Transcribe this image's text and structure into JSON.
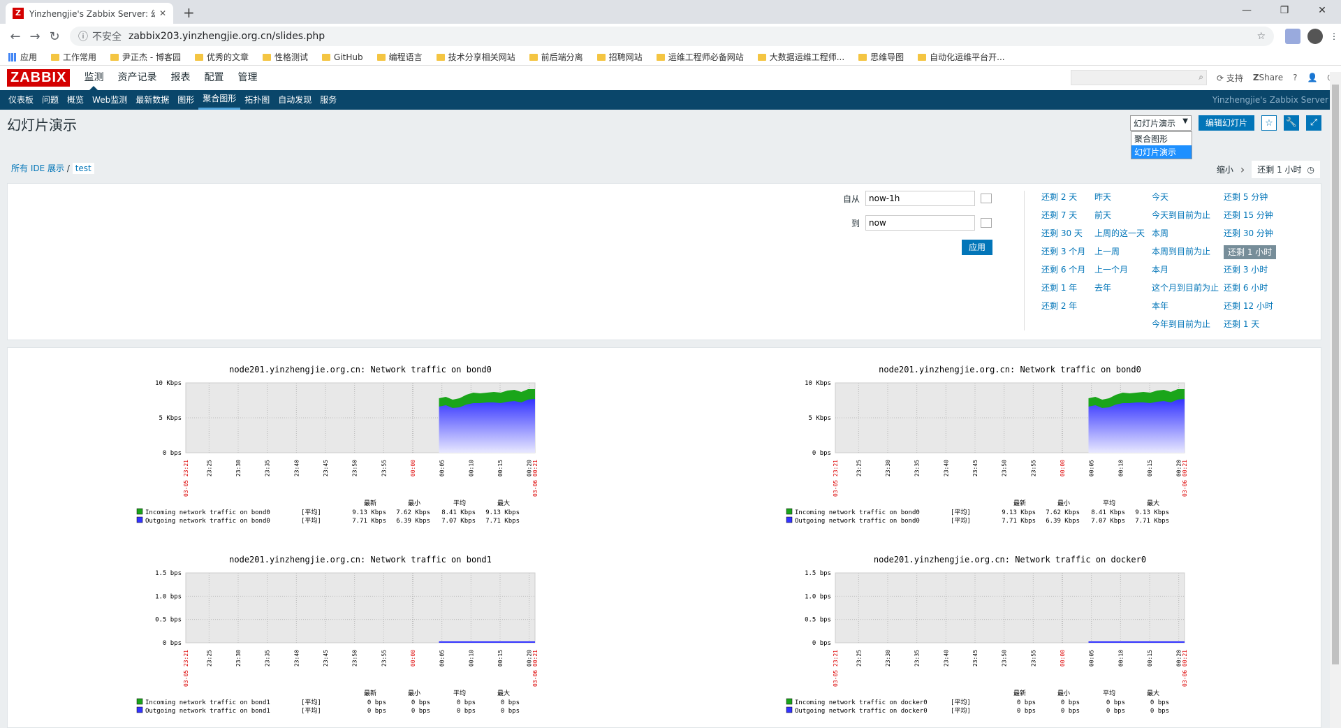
{
  "browser": {
    "tab_title": "Yinzhengjie's Zabbix Server: 幻",
    "insecure": "不安全",
    "url": "zabbix203.yinzhengjie.org.cn/slides.php",
    "bookmarks": [
      "应用",
      "工作常用",
      "尹正杰 - 博客园",
      "优秀的文章",
      "性格测试",
      "GitHub",
      "编程语言",
      "技术分享相关网站",
      "前后端分离",
      "招聘网站",
      "运维工程师必备网站",
      "大数据运维工程师...",
      "思维导图",
      "自动化运维平台开..."
    ]
  },
  "zabbix": {
    "logo": "ZABBIX",
    "top_menu": [
      "监测",
      "资产记录",
      "报表",
      "配置",
      "管理"
    ],
    "support": "支持",
    "share": "Share",
    "help": "?",
    "sub_menu": [
      "仪表板",
      "问题",
      "概览",
      "Web监测",
      "最新数据",
      "图形",
      "聚合图形",
      "拓扑图",
      "自动发现",
      "服务"
    ],
    "server_name": "Yinzhengjie's Zabbix Server",
    "page_title": "幻灯片演示",
    "select_value": "幻灯片演示",
    "select_options": [
      "聚合图形",
      "幻灯片演示"
    ],
    "edit_button": "编辑幻灯片",
    "breadcrumb_root": "所有 IDE 展示",
    "breadcrumb_sep": "/",
    "breadcrumb_leaf": "test",
    "zoom_out": "缩小",
    "time_tab": "还剩 1 小时"
  },
  "filter": {
    "from_label": "自从",
    "from_value": "now-1h",
    "to_label": "到",
    "to_value": "now",
    "apply": "应用",
    "quick": [
      [
        "还剩 2 天",
        "还剩 7 天",
        "还剩 30 天",
        "还剩 3 个月",
        "还剩 6 个月",
        "还剩 1 年",
        "还剩 2 年"
      ],
      [
        "昨天",
        "前天",
        "上周的这一天",
        "上一周",
        "上一个月",
        "去年"
      ],
      [
        "今天",
        "今天到目前为止",
        "本周",
        "本周到目前为止",
        "本月",
        "这个月到目前为止",
        "本年",
        "今年到目前为止"
      ],
      [
        "还剩 5 分钟",
        "还剩 15 分钟",
        "还剩 30 分钟",
        "还剩 1 小时",
        "还剩 3 小时",
        "还剩 6 小时",
        "还剩 12 小时",
        "还剩 1 天"
      ]
    ],
    "active": "还剩 1 小时"
  },
  "graphs": [
    {
      "title": "node201.yinzhengjie.org.cn: Network traffic on bond0",
      "y_ticks": [
        "10 Kbps",
        "5 Kbps",
        "0 bps"
      ],
      "x_ticks": [
        "23:25",
        "23:30",
        "23:35",
        "23:40",
        "23:45",
        "23:50",
        "23:55",
        "00:00",
        "00:05",
        "00:10",
        "00:15",
        "00:20"
      ],
      "x_start": "03-05 23:21",
      "x_end": "03-06 00:21",
      "ymax": 10,
      "legend_header": [
        "最新",
        "最小",
        "平均",
        "最大"
      ],
      "legend": [
        {
          "name": "Incoming network traffic on bond0",
          "func": "[平均]",
          "vals": [
            "9.13 Kbps",
            "7.62 Kbps",
            "8.41 Kbps",
            "9.13 Kbps"
          ],
          "color": "#1aa51a"
        },
        {
          "name": "Outgoing network traffic on bond0",
          "func": "[平均]",
          "vals": [
            "7.71 Kbps",
            "6.39 Kbps",
            "7.07 Kbps",
            "7.71 Kbps"
          ],
          "color": "#3333ff"
        }
      ],
      "series": [
        {
          "name": "Incoming network traffic on bond0",
          "start_min": 43.5,
          "values": [
            7.8,
            8.0,
            7.6,
            7.8,
            8.3,
            8.6,
            8.5,
            8.6,
            8.7,
            8.6,
            8.9,
            9.0,
            8.7,
            9.1,
            9.1
          ]
        },
        {
          "name": "Outgoing network traffic on bond0",
          "start_min": 43.5,
          "values": [
            6.6,
            6.8,
            6.4,
            6.5,
            6.9,
            7.1,
            7.1,
            7.2,
            7.2,
            7.1,
            7.3,
            7.4,
            7.2,
            7.6,
            7.7
          ]
        }
      ]
    },
    {
      "title": "node201.yinzhengjie.org.cn: Network traffic on bond0",
      "y_ticks": [
        "10 Kbps",
        "5 Kbps",
        "0 bps"
      ],
      "x_ticks": [
        "23:25",
        "23:30",
        "23:35",
        "23:40",
        "23:45",
        "23:50",
        "23:55",
        "00:00",
        "00:05",
        "00:10",
        "00:15",
        "00:20"
      ],
      "x_start": "03-05 23:21",
      "x_end": "03-06 00:21",
      "ymax": 10,
      "legend_header": [
        "最新",
        "最小",
        "平均",
        "最大"
      ],
      "legend": [
        {
          "name": "Incoming network traffic on bond0",
          "func": "[平均]",
          "vals": [
            "9.13 Kbps",
            "7.62 Kbps",
            "8.41 Kbps",
            "9.13 Kbps"
          ],
          "color": "#1aa51a"
        },
        {
          "name": "Outgoing network traffic on bond0",
          "func": "[平均]",
          "vals": [
            "7.71 Kbps",
            "6.39 Kbps",
            "7.07 Kbps",
            "7.71 Kbps"
          ],
          "color": "#3333ff"
        }
      ],
      "series": [
        {
          "name": "Incoming network traffic on bond0",
          "start_min": 43.5,
          "values": [
            7.8,
            8.0,
            7.6,
            7.8,
            8.3,
            8.6,
            8.5,
            8.6,
            8.7,
            8.6,
            8.9,
            9.0,
            8.7,
            9.1,
            9.1
          ]
        },
        {
          "name": "Outgoing network traffic on bond0",
          "start_min": 43.5,
          "values": [
            6.6,
            6.8,
            6.4,
            6.5,
            6.9,
            7.1,
            7.1,
            7.2,
            7.2,
            7.1,
            7.3,
            7.4,
            7.2,
            7.6,
            7.7
          ]
        }
      ]
    },
    {
      "title": "node201.yinzhengjie.org.cn: Network traffic on bond1",
      "y_ticks": [
        "1.5 bps",
        "1.0 bps",
        "0.5 bps",
        "0 bps"
      ],
      "x_ticks": [
        "23:25",
        "23:30",
        "23:35",
        "23:40",
        "23:45",
        "23:50",
        "23:55",
        "00:00",
        "00:05",
        "00:10",
        "00:15",
        "00:20"
      ],
      "x_start": "03-05 23:21",
      "x_end": "03-06 00:21",
      "ymax": 1.5,
      "legend_header": [
        "最新",
        "最小",
        "平均",
        "最大"
      ],
      "legend": [
        {
          "name": "Incoming network traffic on bond1",
          "func": "[平均]",
          "vals": [
            "0 bps",
            "0 bps",
            "0 bps",
            "0 bps"
          ],
          "color": "#1aa51a"
        },
        {
          "name": "Outgoing network traffic on bond1",
          "func": "[平均]",
          "vals": [
            "0 bps",
            "0 bps",
            "0 bps",
            "0 bps"
          ],
          "color": "#3333ff"
        }
      ],
      "series": [
        {
          "name": "Outgoing network traffic on bond1",
          "start_min": 43.5,
          "values": [
            0,
            0,
            0,
            0,
            0,
            0,
            0,
            0,
            0,
            0,
            0,
            0,
            0,
            0,
            0
          ]
        }
      ]
    },
    {
      "title": "node201.yinzhengjie.org.cn: Network traffic on docker0",
      "y_ticks": [
        "1.5 bps",
        "1.0 bps",
        "0.5 bps",
        "0 bps"
      ],
      "x_ticks": [
        "23:25",
        "23:30",
        "23:35",
        "23:40",
        "23:45",
        "23:50",
        "23:55",
        "00:00",
        "00:05",
        "00:10",
        "00:15",
        "00:20"
      ],
      "x_start": "03-05 23:21",
      "x_end": "03-06 00:21",
      "ymax": 1.5,
      "legend_header": [
        "最新",
        "最小",
        "平均",
        "最大"
      ],
      "legend": [
        {
          "name": "Incoming network traffic on docker0",
          "func": "[平均]",
          "vals": [
            "0 bps",
            "0 bps",
            "0 bps",
            "0 bps"
          ],
          "color": "#1aa51a"
        },
        {
          "name": "Outgoing network traffic on docker0",
          "func": "[平均]",
          "vals": [
            "0 bps",
            "0 bps",
            "0 bps",
            "0 bps"
          ],
          "color": "#3333ff"
        }
      ],
      "series": [
        {
          "name": "Outgoing network traffic on docker0",
          "start_min": 43.5,
          "values": [
            0,
            0,
            0,
            0,
            0,
            0,
            0,
            0,
            0,
            0,
            0,
            0,
            0,
            0,
            0
          ]
        }
      ]
    }
  ]
}
